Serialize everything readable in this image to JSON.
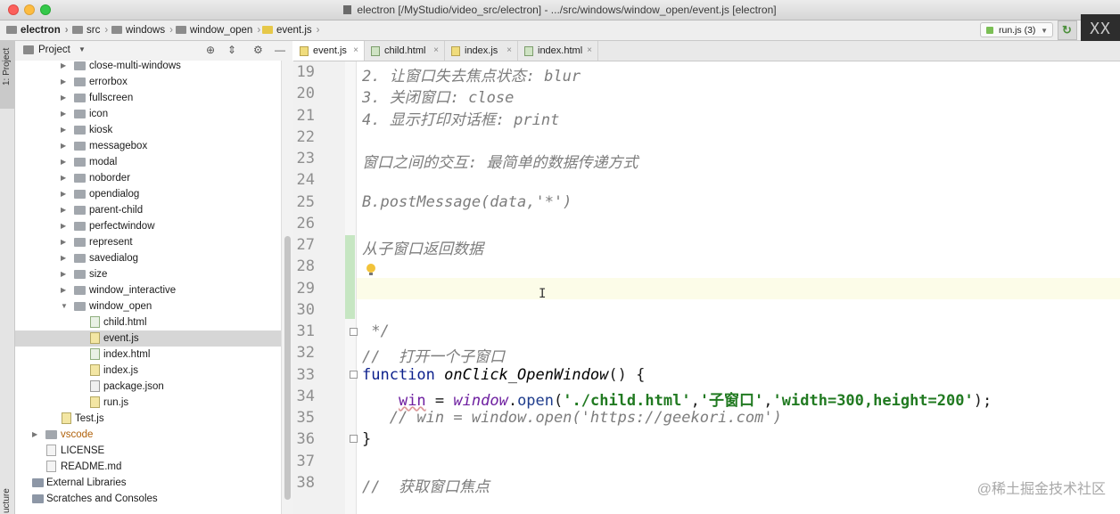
{
  "window": {
    "title": "electron [/MyStudio/video_src/electron] - .../src/windows/window_open/event.js [electron]"
  },
  "breadcrumb": [
    "electron",
    "src",
    "windows",
    "window_open",
    "event.js"
  ],
  "run_config": {
    "label": "run.js (3)"
  },
  "watermark_top": "XX",
  "left_strip": {
    "project_tab": "1: Project",
    "structure_tab": "ucture"
  },
  "project_panel": {
    "title": "Project"
  },
  "tree": [
    {
      "label": "close-multi-windows",
      "kind": "folder"
    },
    {
      "label": "errorbox",
      "kind": "folder"
    },
    {
      "label": "fullscreen",
      "kind": "folder"
    },
    {
      "label": "icon",
      "kind": "folder"
    },
    {
      "label": "kiosk",
      "kind": "folder"
    },
    {
      "label": "messagebox",
      "kind": "folder"
    },
    {
      "label": "modal",
      "kind": "folder"
    },
    {
      "label": "noborder",
      "kind": "folder"
    },
    {
      "label": "opendialog",
      "kind": "folder"
    },
    {
      "label": "parent-child",
      "kind": "folder"
    },
    {
      "label": "perfectwindow",
      "kind": "folder"
    },
    {
      "label": "represent",
      "kind": "folder"
    },
    {
      "label": "savedialog",
      "kind": "folder"
    },
    {
      "label": "size",
      "kind": "folder"
    },
    {
      "label": "window_interactive",
      "kind": "folder"
    },
    {
      "label": "window_open",
      "kind": "folder-open"
    },
    {
      "label": "child.html",
      "kind": "html"
    },
    {
      "label": "event.js",
      "kind": "js",
      "selected": true
    },
    {
      "label": "index.html",
      "kind": "html"
    },
    {
      "label": "index.js",
      "kind": "js"
    },
    {
      "label": "package.json",
      "kind": "json"
    },
    {
      "label": "run.js",
      "kind": "js"
    },
    {
      "label": "Test.js",
      "kind": "js"
    },
    {
      "label": "vscode",
      "kind": "folder",
      "color": "orange"
    },
    {
      "label": "LICENSE",
      "kind": "txt"
    },
    {
      "label": "README.md",
      "kind": "txt"
    },
    {
      "label": "External Libraries",
      "kind": "lib"
    },
    {
      "label": "Scratches and Consoles",
      "kind": "lib"
    }
  ],
  "tabs": [
    {
      "label": "event.js",
      "active": true,
      "type": "js"
    },
    {
      "label": "child.html",
      "type": "html"
    },
    {
      "label": "index.js",
      "type": "js"
    },
    {
      "label": "index.html",
      "type": "html"
    }
  ],
  "code_lines": [
    {
      "n": "19",
      "html": "<span class=\"c\">2. 让窗口失去焦点状态: blur</span>"
    },
    {
      "n": "20",
      "html": "<span class=\"c\">3. 关闭窗口: close</span>"
    },
    {
      "n": "21",
      "html": "<span class=\"c\">4. 显示打印对话框: print</span>"
    },
    {
      "n": "22",
      "html": ""
    },
    {
      "n": "23",
      "html": "<span class=\"c\">窗口之间的交互: 最简单的数据传递方式</span>"
    },
    {
      "n": "24",
      "html": ""
    },
    {
      "n": "25",
      "html": "<span class=\"c\">B.postMessage(data,'*')</span>"
    },
    {
      "n": "26",
      "html": ""
    },
    {
      "n": "27",
      "html": "<span class=\"c\">从子窗口返回数据</span>"
    },
    {
      "n": "28",
      "html": ""
    },
    {
      "n": "29",
      "html": ""
    },
    {
      "n": "30",
      "html": ""
    },
    {
      "n": "31",
      "html": "<span class=\"c\"> */</span>"
    },
    {
      "n": "32",
      "html": "<span class=\"c\">//  打开一个子窗口</span>"
    },
    {
      "n": "33",
      "html": "<span class=\"kw\">function</span> <span class=\"fn\">onClick_OpenWindow</span>() {"
    },
    {
      "n": "34",
      "html": "    <span class=\"vr\">win</span> = <span class=\"gl\">window</span>.<span class=\"method\">open</span>(<span class=\"str\">'./child.html'</span>,<span class=\"str\">'子窗口'</span>,<span class=\"str\">'width=300,height=200'</span>);"
    },
    {
      "n": "35",
      "html": "   <span class=\"c\">// win = window.open('https://geekori.com')</span>"
    },
    {
      "n": "36",
      "html": "}"
    },
    {
      "n": "37",
      "html": ""
    },
    {
      "n": "38",
      "html": "<span class=\"c\">//  获取窗口焦点</span>"
    }
  ],
  "watermark": "@稀土掘金技术社区"
}
